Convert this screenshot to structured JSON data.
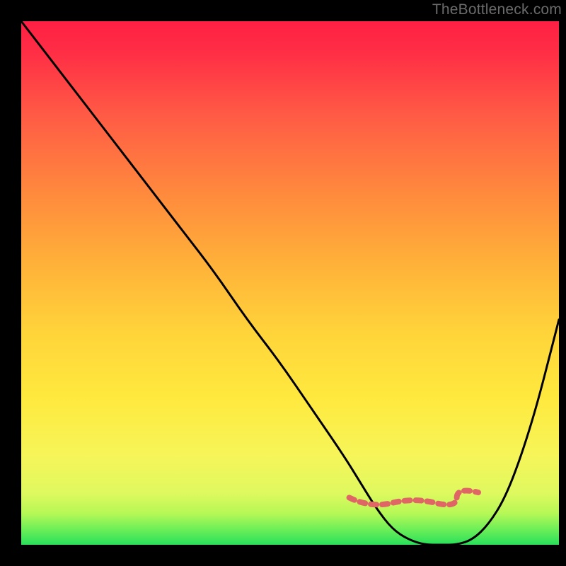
{
  "watermark": "TheBottleneck.com",
  "colors": {
    "background": "#000000",
    "watermark_text": "#6b6b6b",
    "curve_stroke": "#000000",
    "bottom_marker": "#e06666",
    "gradient_stops": [
      "#ff1f44",
      "#ff2e45",
      "#ff5b45",
      "#ff8a3d",
      "#ffb339",
      "#ffd53a",
      "#ffe93e",
      "#f6f559",
      "#dff95f",
      "#b6f856",
      "#6eef58",
      "#28e05a"
    ]
  },
  "chart_data": {
    "type": "line",
    "title": "",
    "xlabel": "",
    "ylabel": "",
    "xlim": [
      0,
      100
    ],
    "ylim": [
      0,
      100
    ],
    "x": [
      0,
      6,
      12,
      18,
      24,
      30,
      36,
      42,
      48,
      54,
      60,
      63,
      66,
      69,
      72,
      75,
      78,
      81,
      84,
      87,
      90,
      93,
      96,
      99,
      100
    ],
    "y": [
      100,
      92,
      84,
      76,
      68,
      60,
      52,
      43,
      35,
      26,
      17,
      12,
      7,
      3,
      1,
      0,
      0,
      0,
      1,
      4,
      9,
      17,
      27,
      39,
      43
    ],
    "series": [
      {
        "name": "bottleneck-curve",
        "x": [
          0,
          6,
          12,
          18,
          24,
          30,
          36,
          42,
          48,
          54,
          60,
          63,
          66,
          69,
          72,
          75,
          78,
          81,
          84,
          87,
          90,
          93,
          96,
          99,
          100
        ],
        "y": [
          100,
          92,
          84,
          76,
          68,
          60,
          52,
          43,
          35,
          26,
          17,
          12,
          7,
          3,
          1,
          0,
          0,
          0,
          1,
          4,
          9,
          17,
          27,
          39,
          43
        ]
      }
    ],
    "marker_segment": {
      "name": "optimal-range",
      "x_start": 61,
      "x_end": 85,
      "y": 9
    },
    "note": "x and y are normalized 0..100 across the visible colored plot area; y=0 is the bottom (green) edge, y=100 is the top (red) edge. Values are read visually from the curve's position relative to the gradient; the image has no numeric axis ticks."
  }
}
